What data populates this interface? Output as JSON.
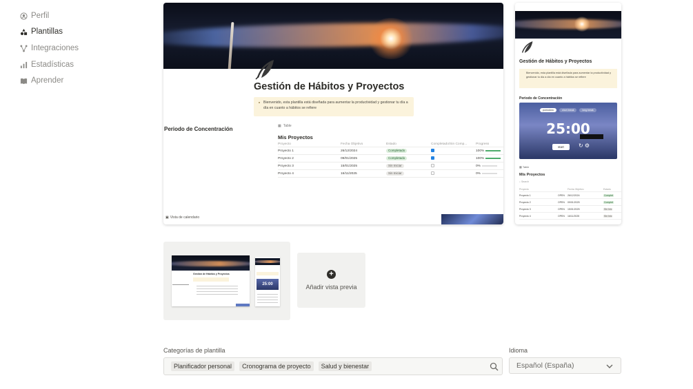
{
  "sidebar": {
    "items": [
      {
        "label": "Perfil",
        "icon": "user-circle-icon",
        "active": false
      },
      {
        "label": "Plantillas",
        "icon": "shapes-icon",
        "active": true
      },
      {
        "label": "Integraciones",
        "icon": "nodes-icon",
        "active": false
      },
      {
        "label": "Estadísticas",
        "icon": "chart-icon",
        "active": false
      },
      {
        "label": "Aprender",
        "icon": "book-icon",
        "active": false
      }
    ]
  },
  "preview": {
    "title": "Gestión de Hábitos y Proyectos",
    "callout": "Bienvenido, esta plantilla está diseñada para aumentar la productividad y gestionar tu día a día en cuanto a hábitos se refiere",
    "concentration_heading": "Periodo de Concentración",
    "table_tab": "Table",
    "table_title": "Mis Proyectos",
    "columns": [
      "Proyecto",
      "Fecha Objetivo",
      "Estado",
      "Completado/Sin Comp...",
      "Progress"
    ],
    "rows": [
      {
        "name": "Proyecto 1",
        "date": "26/12/2024",
        "status": "Completado",
        "done": true,
        "progress": "100%",
        "progress_value": 1
      },
      {
        "name": "Proyecto 2",
        "date": "09/01/2025",
        "status": "Completado",
        "done": true,
        "progress": "100%",
        "progress_value": 1
      },
      {
        "name": "Proyecto 3",
        "date": "15/01/2025",
        "status": "Sin Iniciar",
        "done": false,
        "progress": "0%",
        "progress_value": 0
      },
      {
        "name": "Proyecto 4",
        "date": "16/11/2025",
        "status": "Sin Iniciar",
        "done": false,
        "progress": "0%",
        "progress_value": 0
      }
    ],
    "calendar_label": "Vista de calendario"
  },
  "mobile": {
    "title": "Gestión de Hábitos y Proyectos",
    "callout": "Bienvenido, esta plantilla está diseñada para aumentar la productividad y gestionar tu día a día en cuanto a hábitos se refiere",
    "concentration_heading": "Periodo de Concentración",
    "timer_tabs": [
      "pomodoro",
      "short break",
      "long break"
    ],
    "timer": "25:00",
    "start_label": "start",
    "table_tab": "Table",
    "table_title": "Mis Proyectos",
    "search": "Search",
    "columns": [
      "Proyecto",
      "",
      "Fecha Objetivo",
      "Estado"
    ],
    "rows": [
      {
        "name": "Proyecto 1",
        "tag": "OPEN",
        "date": "26/12/2024",
        "status": "Complet"
      },
      {
        "name": "Proyecto 2",
        "tag": "OPEN",
        "date": "09/01/2025",
        "status": "Complet"
      },
      {
        "name": "Proyecto 3",
        "tag": "OPEN",
        "date": "15/01/2025",
        "status": "Sin Inic"
      },
      {
        "name": "Proyecto 4",
        "tag": "OPEN",
        "date": "16/11/2025",
        "status": "Sin Inic"
      }
    ]
  },
  "thumbnail": {
    "timer": "25:00"
  },
  "add_preview": {
    "label": "Añadir vista previa"
  },
  "categories": {
    "label": "Categorías de plantilla",
    "chips": [
      "Planificador personal",
      "Cronograma de proyecto",
      "Salud y bienestar"
    ]
  },
  "language": {
    "label": "Idioma",
    "value": "Español (España)"
  }
}
